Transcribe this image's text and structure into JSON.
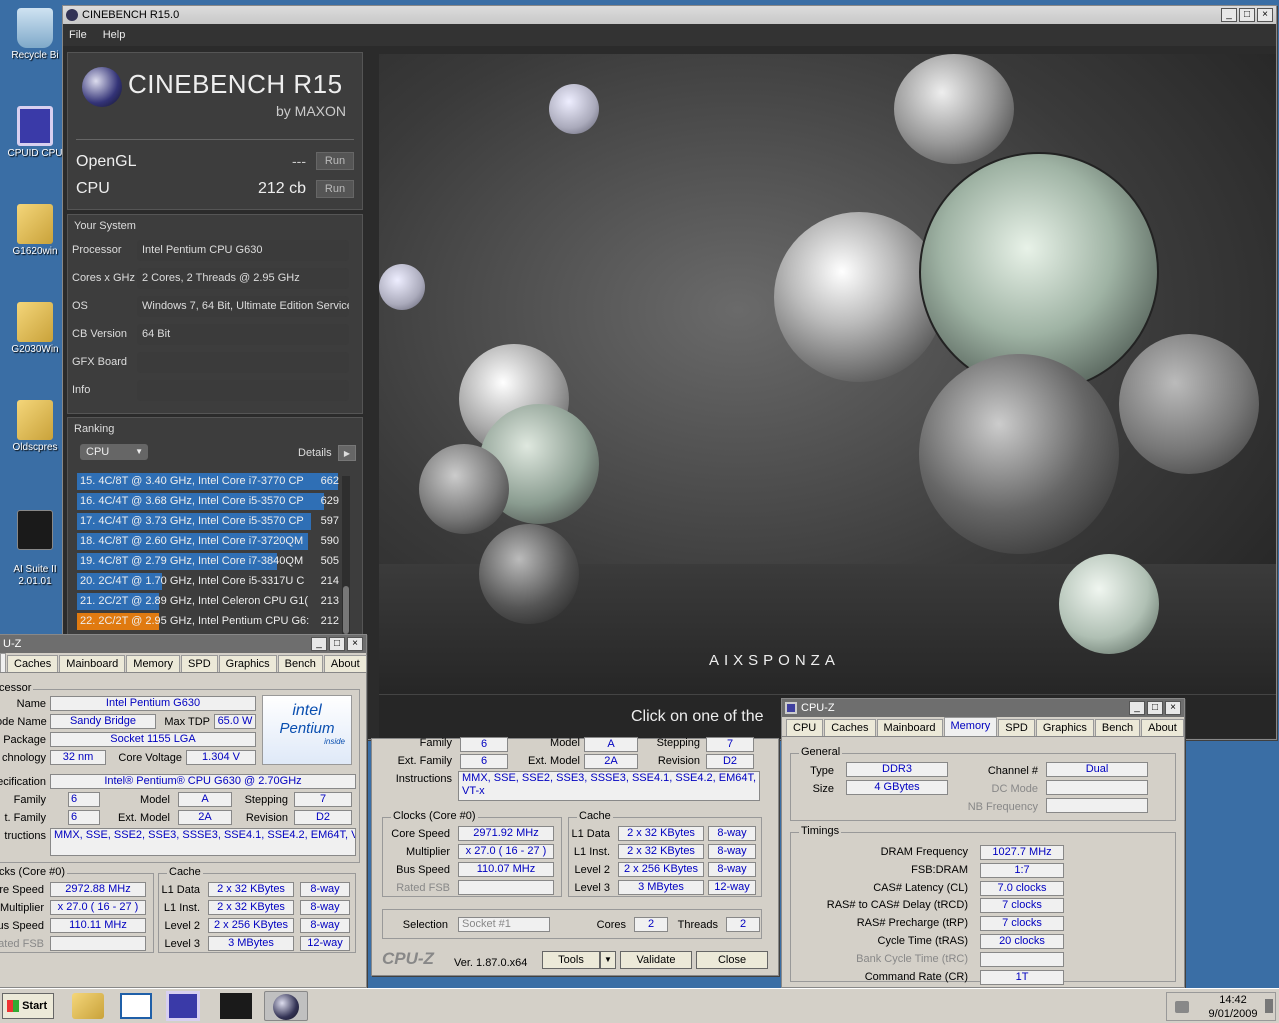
{
  "desktop": {
    "icons": [
      "Recycle Bi",
      "CPUID CPU",
      "G1620win",
      "G2030Win",
      "Oldscpres",
      "AI Suite II\n2.01.01"
    ]
  },
  "cinebench": {
    "title": "CINEBENCH R15.0",
    "menu": [
      "File",
      "Help"
    ],
    "logo": "CINEBENCH R15",
    "by": "by MAXON",
    "opengl_label": "OpenGL",
    "opengl_value": "---",
    "cpu_label": "CPU",
    "cpu_value": "212 cb",
    "run": "Run",
    "system_title": "Your System",
    "system": [
      {
        "k": "Processor",
        "v": "Intel Pentium CPU G630"
      },
      {
        "k": "Cores x GHz",
        "v": "2 Cores, 2 Threads @ 2.95 GHz"
      },
      {
        "k": "OS",
        "v": "Windows 7, 64 Bit, Ultimate Edition Service"
      },
      {
        "k": "CB Version",
        "v": "64 Bit"
      },
      {
        "k": "GFX Board",
        "v": ""
      },
      {
        "k": "Info",
        "v": ""
      }
    ],
    "ranking_title": "Ranking",
    "ranking_select": "CPU",
    "details": "Details",
    "ranking": [
      {
        "t": "15. 4C/8T @ 3.40 GHz,  Intel Core i7-3770 CP",
        "s": "662",
        "w": 0.98,
        "c": "#2f6fb5"
      },
      {
        "t": "16. 4C/4T @ 3.68 GHz,  Intel Core i5-3570 CP",
        "s": "629",
        "w": 0.93,
        "c": "#2f6fb5"
      },
      {
        "t": "17. 4C/4T @ 3.73 GHz,  Intel Core i5-3570 CP",
        "s": "597",
        "w": 0.88,
        "c": "#2f6fb5"
      },
      {
        "t": "18. 4C/8T @ 2.60 GHz, Intel Core i7-3720QM",
        "s": "590",
        "w": 0.87,
        "c": "#2f6fb5"
      },
      {
        "t": "19. 4C/8T @ 2.79 GHz,  Intel Core i7-3840QM",
        "s": "505",
        "w": 0.75,
        "c": "#2f6fb5"
      },
      {
        "t": "20. 2C/4T @ 1.70 GHz,  Intel Core i5-3317U C",
        "s": "214",
        "w": 0.32,
        "c": "#2f6fb5"
      },
      {
        "t": "21. 2C/2T @ 2.89 GHz,  Intel Celeron CPU G1(",
        "s": "213",
        "w": 0.31,
        "c": "#2f6fb5"
      },
      {
        "t": "22. 2C/2T @ 2.95 GHz,  Intel Pentium CPU G6:",
        "s": "212",
        "w": 0.31,
        "c": "#e07a10"
      }
    ],
    "render_prompt": "Click on one of the",
    "render_brand": "AIXSPONZA"
  },
  "cpuz1": {
    "title": "U-Z",
    "tabs": [
      "Caches",
      "Mainboard",
      "Memory",
      "SPD",
      "Graphics",
      "Bench",
      "About"
    ],
    "grp_proc": "cessor",
    "name_l": "Name",
    "name_v": "Intel Pentium G630",
    "code_l": "ode Name",
    "code_v": "Sandy Bridge",
    "tdp_l": "Max TDP",
    "tdp_v": "65.0 W",
    "pkg_l": "Package",
    "pkg_v": "Socket 1155 LGA",
    "tech_l": "chnology",
    "tech_v": "32 nm",
    "volt_l": "Core Voltage",
    "volt_v": "1.304 V",
    "spec_l": "ecification",
    "spec_v": "Intel® Pentium® CPU G630 @ 2.70GHz",
    "fam_l": "Family",
    "fam_v": "6",
    "mod_l": "Model",
    "mod_v": "A",
    "step_l": "Stepping",
    "step_v": "7",
    "efam_l": "t. Family",
    "efam_v": "6",
    "emod_l": "Ext. Model",
    "emod_v": "2A",
    "rev_l": "Revision",
    "rev_v": "D2",
    "inst_l": "tructions",
    "inst_v": "MMX, SSE, SSE2, SSE3, SSSE3, SSE4.1, SSE4.2, EM64T, VT-x",
    "clk_t": "cks (Core #0)",
    "cs_l": "re Speed",
    "cs_v": "2972.88 MHz",
    "mul_l": "Multiplier",
    "mul_v": "x 27.0 ( 16 - 27 )",
    "bus_l": "us Speed",
    "bus_v": "110.11 MHz",
    "rfsb_l": "ated FSB",
    "cache_t": "Cache",
    "l1d_l": "L1 Data",
    "l1d_v": "2 x 32 KBytes",
    "l1d_w": "8-way",
    "l1i_l": "L1 Inst.",
    "l1i_v": "2 x 32 KBytes",
    "l1i_w": "8-way",
    "l2_l": "Level 2",
    "l2_v": "2 x 256 KBytes",
    "l2_w": "8-way",
    "l3_l": "Level 3",
    "l3_v": "3 MBytes",
    "l3_w": "12-way",
    "logo_top": "intel",
    "logo_mid": "Pentium",
    "logo_bot": "inside"
  },
  "cpuz2": {
    "fam_l": "Family",
    "fam_v": "6",
    "mod_l": "Model",
    "mod_v": "A",
    "step_l": "Stepping",
    "step_v": "7",
    "efam_l": "Ext. Family",
    "efam_v": "6",
    "emod_l": "Ext. Model",
    "emod_v": "2A",
    "rev_l": "Revision",
    "rev_v": "D2",
    "inst_l": "Instructions",
    "inst_v": "MMX, SSE, SSE2, SSE3, SSSE3, SSE4.1, SSE4.2, EM64T, VT-x",
    "clk_t": "Clocks (Core #0)",
    "cs_l": "Core Speed",
    "cs_v": "2971.92 MHz",
    "mul_l": "Multiplier",
    "mul_v": "x 27.0 ( 16 - 27 )",
    "bus_l": "Bus Speed",
    "bus_v": "110.07 MHz",
    "rfsb_l": "Rated FSB",
    "cache_t": "Cache",
    "l1d_l": "L1 Data",
    "l1d_v": "2 x 32 KBytes",
    "l1d_w": "8-way",
    "l1i_l": "L1 Inst.",
    "l1i_v": "2 x 32 KBytes",
    "l1i_w": "8-way",
    "l2_l": "Level 2",
    "l2_v": "2 x 256 KBytes",
    "l2_w": "8-way",
    "l3_l": "Level 3",
    "l3_v": "3 MBytes",
    "l3_w": "12-way",
    "sel_l": "Selection",
    "sel_v": "Socket #1",
    "cores_l": "Cores",
    "cores_v": "2",
    "thr_l": "Threads",
    "thr_v": "2",
    "brand": "CPU-Z",
    "ver": "Ver. 1.87.0.x64",
    "tools": "Tools",
    "validate": "Validate",
    "close": "Close"
  },
  "cpuz3": {
    "title": "CPU-Z",
    "tabs": [
      "CPU",
      "Caches",
      "Mainboard",
      "Memory",
      "SPD",
      "Graphics",
      "Bench",
      "About"
    ],
    "gen_t": "General",
    "type_l": "Type",
    "type_v": "DDR3",
    "ch_l": "Channel #",
    "ch_v": "Dual",
    "size_l": "Size",
    "size_v": "4 GBytes",
    "dc_l": "DC Mode",
    "nb_l": "NB Frequency",
    "tim_t": "Timings",
    "timings": [
      {
        "k": "DRAM Frequency",
        "v": "1027.7 MHz"
      },
      {
        "k": "FSB:DRAM",
        "v": "1:7"
      },
      {
        "k": "CAS# Latency (CL)",
        "v": "7.0 clocks"
      },
      {
        "k": "RAS# to CAS# Delay (tRCD)",
        "v": "7 clocks"
      },
      {
        "k": "RAS# Precharge (tRP)",
        "v": "7 clocks"
      },
      {
        "k": "Cycle Time (tRAS)",
        "v": "20 clocks"
      },
      {
        "k": "Bank Cycle Time (tRC)",
        "v": ""
      },
      {
        "k": "Command Rate (CR)",
        "v": "1T"
      }
    ]
  },
  "taskbar": {
    "start": "Start",
    "time": "14:42",
    "date": "9/01/2009"
  }
}
